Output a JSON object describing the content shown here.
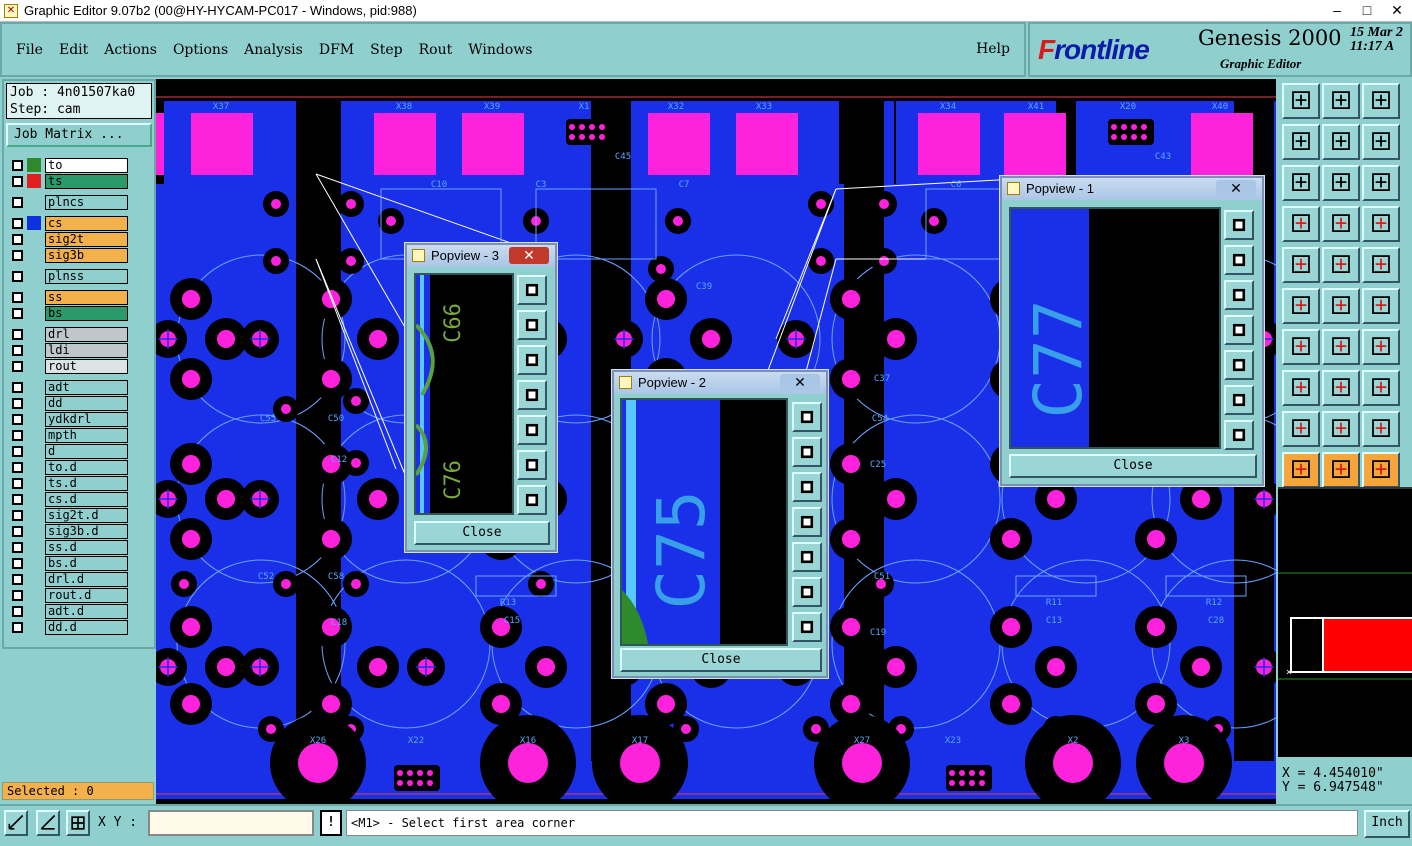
{
  "window": {
    "title": "Graphic Editor 9.07b2 (00@HY-HYCAM-PC017 - Windows, pid:988)"
  },
  "menu": {
    "items": [
      "File",
      "Edit",
      "Actions",
      "Options",
      "Analysis",
      "DFM",
      "Step",
      "Rout",
      "Windows"
    ],
    "help": "Help"
  },
  "brand": {
    "logo_f": "F",
    "logo_rest": "rontline",
    "product": "Genesis 2000",
    "subtitle": "Graphic Editor",
    "date": "15 Mar 2",
    "time": "11:17 A"
  },
  "job": {
    "job_line": "Job : 4n01507ka0",
    "step_line": "Step: cam",
    "matrix_button": "Job Matrix ..."
  },
  "layers": [
    {
      "name": "to",
      "color": "#2d8a2d",
      "bg": "#ffffff"
    },
    {
      "name": "ts",
      "color": "#e02020",
      "bg": "#2a9a6a"
    },
    {
      "gap": true
    },
    {
      "name": "plncs",
      "color": "",
      "bg": "#8fd0cf"
    },
    {
      "gap": true
    },
    {
      "name": "cs",
      "color": "#1030e0",
      "bg": "#f2b14a"
    },
    {
      "name": "sig2t",
      "color": "",
      "bg": "#f2b14a"
    },
    {
      "name": "sig3b",
      "color": "",
      "bg": "#f2b14a"
    },
    {
      "gap": true
    },
    {
      "name": "plnss",
      "color": "",
      "bg": "#8fd0cf"
    },
    {
      "gap": true
    },
    {
      "name": "ss",
      "color": "",
      "bg": "#f2b14a"
    },
    {
      "name": "bs",
      "color": "",
      "bg": "#2a9a6a"
    },
    {
      "gap": true
    },
    {
      "name": "drl",
      "color": "",
      "bg": "#bfc7cc"
    },
    {
      "name": "ldi",
      "color": "",
      "bg": "#bfc7cc"
    },
    {
      "name": "rout",
      "color": "",
      "bg": "#dde2e4"
    },
    {
      "gap": true
    },
    {
      "name": "adt",
      "color": "",
      "bg": "#8fd0cf"
    },
    {
      "name": "dd",
      "color": "",
      "bg": "#8fd0cf"
    },
    {
      "name": "ydkdrl",
      "color": "",
      "bg": "#8fd0cf"
    },
    {
      "name": "mpth",
      "color": "",
      "bg": "#8fd0cf"
    },
    {
      "name": "d",
      "color": "",
      "bg": "#8fd0cf"
    },
    {
      "name": "to.d",
      "color": "",
      "bg": "#8fd0cf"
    },
    {
      "name": "ts.d",
      "color": "",
      "bg": "#8fd0cf"
    },
    {
      "name": "cs.d",
      "color": "",
      "bg": "#8fd0cf"
    },
    {
      "name": "sig2t.d",
      "color": "",
      "bg": "#8fd0cf"
    },
    {
      "name": "sig3b.d",
      "color": "",
      "bg": "#8fd0cf"
    },
    {
      "name": "ss.d",
      "color": "",
      "bg": "#8fd0cf"
    },
    {
      "name": "bs.d",
      "color": "",
      "bg": "#8fd0cf"
    },
    {
      "name": "drl.d",
      "color": "",
      "bg": "#8fd0cf"
    },
    {
      "name": "rout.d",
      "color": "",
      "bg": "#8fd0cf"
    },
    {
      "name": "adt.d",
      "color": "",
      "bg": "#8fd0cf"
    },
    {
      "name": "dd.d",
      "color": "",
      "bg": "#8fd0cf"
    }
  ],
  "selected": "Selected : 0",
  "board_labels": {
    "top": [
      "X37",
      "X38",
      "X39",
      "X1",
      "X32",
      "X33",
      "X34",
      "X41",
      "X20",
      "X40"
    ],
    "bottom": [
      "X26",
      "X22",
      "X16",
      "X17",
      "X27",
      "X23",
      "X2",
      "X3"
    ],
    "refdes": [
      "C10",
      "C3",
      "C7",
      "C6",
      "C45",
      "C43",
      "C39",
      "C12",
      "C25",
      "C18",
      "C15",
      "C19",
      "C13",
      "C28",
      "R13",
      "R11",
      "R12",
      "C37",
      "C55",
      "C50",
      "C54",
      "C52",
      "C58",
      "C51"
    ]
  },
  "popviews": {
    "p1": {
      "title": "Popview - 1",
      "label": "C77",
      "close": "Close"
    },
    "p2": {
      "title": "Popview - 2",
      "label": "C75",
      "close": "Close"
    },
    "p3": {
      "title": "Popview - 3",
      "label_a": "C66",
      "label_b": "C76",
      "close": "Close"
    }
  },
  "coords": {
    "x": "X = 4.454010\"",
    "y": "Y = 6.947548\""
  },
  "bottom": {
    "xy_label": "X Y :",
    "xy_value": "",
    "status": "<M1> - Select first area corner",
    "units": "Inch"
  }
}
